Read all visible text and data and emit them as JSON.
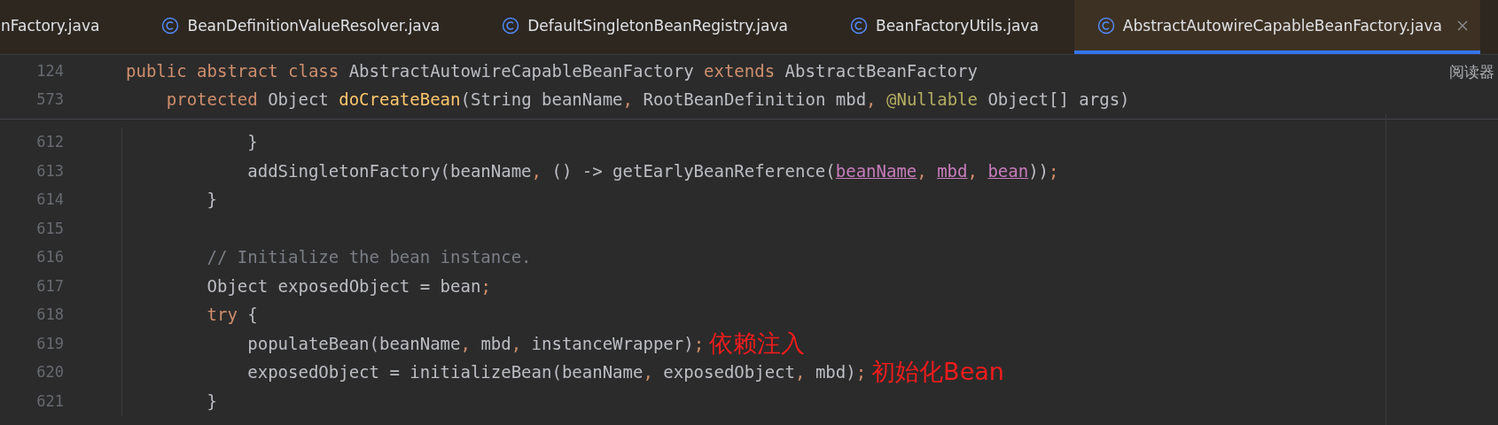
{
  "tabs": [
    {
      "label": "nFactory.java",
      "icon": false,
      "selected": false
    },
    {
      "label": "BeanDefinitionValueResolver.java",
      "icon": true,
      "selected": false
    },
    {
      "label": "DefaultSingletonBeanRegistry.java",
      "icon": true,
      "selected": false
    },
    {
      "label": "BeanFactoryUtils.java",
      "icon": true,
      "selected": false
    },
    {
      "label": "AbstractAutowireCapableBeanFactory.java",
      "icon": true,
      "selected": true
    }
  ],
  "side_label": "阅读器",
  "sticky_lines": [
    {
      "number": "124",
      "tokens": [
        {
          "kind": "keyword",
          "text": "public abstract class "
        },
        {
          "kind": "plain",
          "text": "AbstractAutowireCapableBeanFactory "
        },
        {
          "kind": "keyword",
          "text": "extends "
        },
        {
          "kind": "plain",
          "text": "AbstractBeanFactory"
        }
      ]
    },
    {
      "number": "573",
      "tokens": [
        {
          "kind": "keyword",
          "text": "    protected "
        },
        {
          "kind": "plain",
          "text": "Object "
        },
        {
          "kind": "method",
          "text": "doCreateBean"
        },
        {
          "kind": "plain",
          "text": "(String beanName"
        },
        {
          "kind": "keyword",
          "text": ", "
        },
        {
          "kind": "plain",
          "text": "RootBeanDefinition mbd"
        },
        {
          "kind": "keyword",
          "text": ", "
        },
        {
          "kind": "annotation",
          "text": "@Nullable "
        },
        {
          "kind": "plain",
          "text": "Object[] args)"
        }
      ]
    }
  ],
  "lines": [
    {
      "number": "612",
      "tokens": [
        {
          "kind": "plain",
          "text": "            }"
        }
      ]
    },
    {
      "number": "613",
      "tokens": [
        {
          "kind": "plain",
          "text": "            addSingletonFactory(beanName"
        },
        {
          "kind": "keyword",
          "text": ", "
        },
        {
          "kind": "plain",
          "text": "() -> getEarlyBeanReference("
        },
        {
          "kind": "param",
          "text": "beanName"
        },
        {
          "kind": "keyword",
          "text": ", "
        },
        {
          "kind": "param",
          "text": "mbd"
        },
        {
          "kind": "keyword",
          "text": ", "
        },
        {
          "kind": "param",
          "text": "bean"
        },
        {
          "kind": "plain",
          "text": "))"
        },
        {
          "kind": "keyword",
          "text": ";"
        }
      ]
    },
    {
      "number": "614",
      "tokens": [
        {
          "kind": "plain",
          "text": "        }"
        }
      ]
    },
    {
      "number": "615"
    },
    {
      "number": "616",
      "tokens": [
        {
          "kind": "comment",
          "text": "        // Initialize the bean instance."
        }
      ]
    },
    {
      "number": "617",
      "tokens": [
        {
          "kind": "plain",
          "text": "        Object exposedObject = bean"
        },
        {
          "kind": "keyword",
          "text": ";"
        }
      ]
    },
    {
      "number": "618",
      "tokens": [
        {
          "kind": "keyword",
          "text": "        try "
        },
        {
          "kind": "plain",
          "text": "{"
        }
      ]
    },
    {
      "number": "619",
      "tokens": [
        {
          "kind": "plain",
          "text": "            populateBean(beanName"
        },
        {
          "kind": "keyword",
          "text": ", "
        },
        {
          "kind": "plain",
          "text": "mbd"
        },
        {
          "kind": "keyword",
          "text": ", "
        },
        {
          "kind": "plain",
          "text": "instanceWrapper)"
        },
        {
          "kind": "keyword",
          "text": ";"
        }
      ],
      "note": "依赖注入"
    },
    {
      "number": "620",
      "tokens": [
        {
          "kind": "plain",
          "text": "            exposedObject = initializeBean(beanName"
        },
        {
          "kind": "keyword",
          "text": ", "
        },
        {
          "kind": "plain",
          "text": "exposedObject"
        },
        {
          "kind": "keyword",
          "text": ", "
        },
        {
          "kind": "plain",
          "text": "mbd)"
        },
        {
          "kind": "keyword",
          "text": ";"
        }
      ],
      "note": "初始化Bean"
    },
    {
      "number": "621",
      "tokens": [
        {
          "kind": "plain",
          "text": "        }"
        }
      ]
    }
  ]
}
